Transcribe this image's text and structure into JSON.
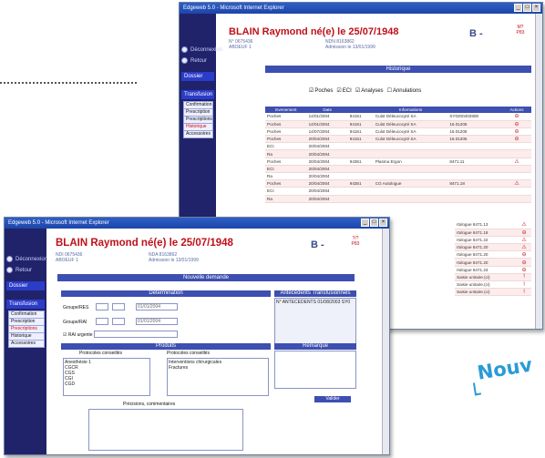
{
  "back_window": {
    "title": "Edgeweb 5.0 - Microsoft Internet Explorer",
    "patient_name": "BLAIN Raymond né(e) le 25/07/1948",
    "badge": "B -",
    "header_info_left": [
      "N° 0675436",
      "ABOEUF 1"
    ],
    "header_info_mid": [
      "NDN 8163862",
      "Admission le 13/01/1999"
    ],
    "header_red": [
      "M?",
      "P83"
    ],
    "sidebar": {
      "nav": [
        "Déconnexion",
        "Retour"
      ],
      "dossier": "Dossier",
      "transfusion": "Transfusion",
      "items": [
        "Confirmation",
        "Prescription",
        "Prescriptions",
        "Historique",
        "Accessoires"
      ]
    },
    "section_title": "Historique",
    "filters": [
      {
        "label": "Poches",
        "checked": true
      },
      {
        "label": "ECI",
        "checked": true
      },
      {
        "label": "Analyses",
        "checked": true
      },
      {
        "label": "Annulations",
        "checked": false
      }
    ],
    "table": {
      "headers": [
        "Evenement",
        "Date",
        "",
        "Informations",
        "",
        "Actions"
      ],
      "rows": [
        {
          "event": "Poches",
          "date": "14/01/2004",
          "code": "94151",
          "info": "Culot Déleucocyté SA",
          "ref": "SY0200402808",
          "action": "⊖"
        },
        {
          "event": "Poches",
          "date": "14/01/2004",
          "code": "94151",
          "info": "Culot Déleucocyté SA",
          "ref": "16.01205",
          "action": "⊖"
        },
        {
          "event": "Poches",
          "date": "14/07/2004",
          "code": "94151",
          "info": "Culot Déleucocyté SA",
          "ref": "16.01205",
          "action": "⊖"
        },
        {
          "event": "Poches",
          "date": "20/04/2004",
          "code": "94151",
          "info": "Culot Déleucocyté SA",
          "ref": "16.01205",
          "action": "⊖"
        },
        {
          "event": "ECI",
          "date": "20/04/2004",
          "code": "",
          "info": "",
          "ref": "",
          "action": ""
        },
        {
          "event": "Ra",
          "date": "20/04/2004",
          "code": "",
          "info": "",
          "ref": "",
          "action": ""
        },
        {
          "event": "Poches",
          "date": "20/04/2004",
          "code": "94351",
          "info": "Plasma Ergon",
          "ref": "8471.11",
          "action": "⚠"
        },
        {
          "event": "ECI",
          "date": "20/04/2004",
          "code": "",
          "info": "",
          "ref": "",
          "action": ""
        },
        {
          "event": "Ra",
          "date": "20/04/2004",
          "code": "",
          "info": "",
          "ref": "",
          "action": ""
        },
        {
          "event": "Poches",
          "date": "20/04/2004",
          "code": "94351",
          "info": "CG Autologue",
          "ref": "8471.18",
          "action": "⚠"
        },
        {
          "event": "ECI",
          "date": "20/04/2004",
          "code": "",
          "info": "",
          "ref": "",
          "action": ""
        },
        {
          "event": "Ra",
          "date": "20/04/2004",
          "code": "",
          "info": "",
          "ref": "",
          "action": ""
        }
      ],
      "extra_rows": [
        {
          "info": "rtologue 8471.13",
          "action": "⚠"
        },
        {
          "info": "rtologue 8471.18",
          "action": "⊖"
        },
        {
          "info": "rtologue 8471.22",
          "action": "⚠"
        },
        {
          "info": "rtologue 8471.20",
          "action": "⚠"
        },
        {
          "info": "rtologue 8471.20",
          "action": "⊖"
        },
        {
          "info": "rtologue 8471.20",
          "action": "⊖"
        },
        {
          "info": "rtologue 8471.23",
          "action": "⊖"
        },
        {
          "info": "Saisie unitaire.(ci)",
          "action": "!"
        },
        {
          "info": "Saisie unitaire.(ci)",
          "action": "!"
        },
        {
          "info": "Saisie unitaire.(ci)",
          "action": "!"
        }
      ]
    }
  },
  "front_window": {
    "title": "Edgeweb 5.0 - Microsoft Internet Explorer",
    "patient_name": "BLAIN Raymond né(e) le 25/07/1948",
    "badge": "B -",
    "header_info_left": [
      "NDI 0675436",
      "ABOEUF 1"
    ],
    "header_info_mid": [
      "NDA 8163862",
      "Admission le 13/01/1999"
    ],
    "header_red": [
      "?/?",
      "P83"
    ],
    "sidebar": {
      "nav": [
        "Déconnexion",
        "Retour"
      ],
      "dossier": "Dossier",
      "transfusion": "Transfusion",
      "items": [
        "Confirmation",
        "Prescription",
        "Prescriptions",
        "Historique",
        "Accessoires"
      ]
    },
    "section_title": "Nouvelle demande",
    "left_panel_title": "Détermination",
    "rows": [
      {
        "label": "Groupe/RES",
        "value": "01/01/2004"
      },
      {
        "label": "Groupe/RAI",
        "value": "01/01/2004"
      }
    ],
    "check_label": "RAI urgente",
    "check_value": "",
    "right_panel_title": "Antécédents Transfusionnels",
    "right_panel_text": "N° ANTECEDENTS 01/08/2003 SY0",
    "products_title": "Produits",
    "col_left_title": "Protocoles conseillés",
    "col_right_title": "Protocoles conseillés",
    "left_list": [
      "Anesthésie 1",
      "CGCR",
      "CGS",
      "CGI",
      "CGD"
    ],
    "right_list": [
      "Interventions chirurgicales",
      "Fractures"
    ],
    "remarks_title": "Remarque",
    "validate_label": "Valider",
    "comments_label": "Précisions, commentaires"
  },
  "nouv_text": "Nouv"
}
